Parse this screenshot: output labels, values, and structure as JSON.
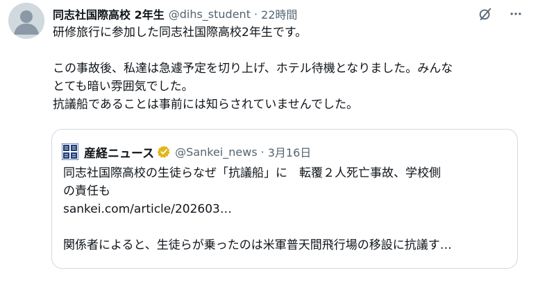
{
  "tweet": {
    "author": {
      "display_name": "同志社国際高校 2年生",
      "handle": "@dihs_student",
      "avatar_icon": "default-avatar-icon"
    },
    "separator": "·",
    "timestamp": "22時間",
    "actions": {
      "grok_icon": "grok-icon",
      "more_icon": "more-icon"
    },
    "text_lines": [
      "研修旅行に参加した同志社国際高校2年生です。",
      "",
      "この事故後、私達は急遽予定を切り上げ、ホテル待機となりました。みんな",
      "とても暗い雰囲気でした。",
      "抗議船であることは事前には知らされていませんでした。"
    ]
  },
  "quote": {
    "logo_icon": "sankei-logo-icon",
    "display_name": "産経ニュース",
    "verified_icon": "verified-gold-badge-icon",
    "handle": "@Sankei_news",
    "separator": "·",
    "date": "3月16日",
    "text_lines": [
      "同志社国際高校の生徒らなぜ「抗議船」に　転覆２人死亡事故、学校側",
      "の責任も",
      "sankei.com/article/202603…",
      "",
      "関係者によると、生徒らが乗ったのは米軍普天間飛行場の移設に抗議す…"
    ]
  },
  "colors": {
    "text_primary": "#0f1419",
    "text_secondary": "#536471",
    "border": "#cfd9de",
    "verified_gold": "#e2b719"
  }
}
